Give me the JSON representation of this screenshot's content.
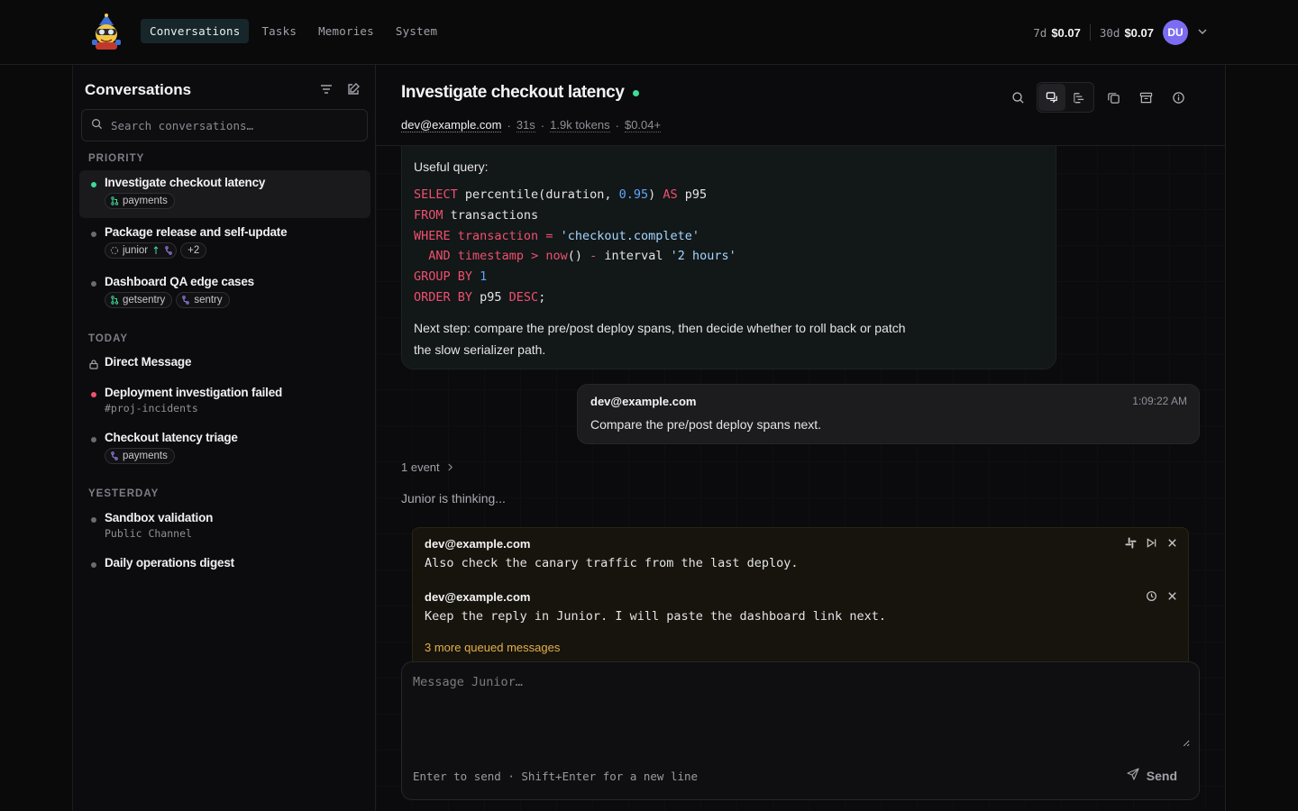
{
  "nav": {
    "items": [
      {
        "label": "Conversations",
        "active": true
      },
      {
        "label": "Tasks",
        "active": false
      },
      {
        "label": "Memories",
        "active": false
      },
      {
        "label": "System",
        "active": false
      }
    ]
  },
  "costs": {
    "week_label": "7d",
    "week_value": "$0.07",
    "month_label": "30d",
    "month_value": "$0.07",
    "avatar_initials": "DU"
  },
  "sidebar": {
    "title": "Conversations",
    "search_placeholder": "Search conversations…",
    "sections": {
      "priority": "PRIORITY",
      "today": "TODAY",
      "yesterday": "YESTERDAY"
    },
    "conversations": [
      {
        "title": "Investigate checkout latency",
        "tags": [
          "payments"
        ],
        "status": "active"
      },
      {
        "title": "Package release and self-update",
        "tags": [
          "junior",
          "+2"
        ]
      },
      {
        "title": "Dashboard QA edge cases",
        "tags": [
          "getsentry",
          "sentry"
        ]
      },
      {
        "title": "Direct Message"
      },
      {
        "title": "Deployment investigation failed",
        "sub": "#proj-incidents",
        "status": "failed"
      },
      {
        "title": "Checkout latency triage",
        "tags": [
          "payments"
        ]
      },
      {
        "title": "Sandbox validation",
        "sub": "Public Channel"
      },
      {
        "title": "Daily operations digest"
      }
    ]
  },
  "header": {
    "title": "Investigate checkout latency",
    "user": "dev@example.com",
    "duration": "31s",
    "tokens": "1.9k tokens",
    "cost": "$0.04+"
  },
  "assistant": {
    "intro": "Useful query:",
    "next_step": "Next step: compare the pre/post deploy spans, then decide whether to roll back or patch the slow serializer path."
  },
  "user_message": {
    "name": "dev@example.com",
    "time": "1:09:22 AM",
    "text": "Compare the pre/post deploy spans next."
  },
  "events_label": "1 event",
  "thinking": "Junior is thinking...",
  "queue": {
    "items": [
      {
        "name": "dev@example.com",
        "text": "Also check the canary traffic from the last deploy."
      },
      {
        "name": "dev@example.com",
        "text": "Keep the reply in Junior. I will paste the dashboard link next."
      }
    ],
    "more": "3 more queued messages"
  },
  "composer": {
    "placeholder": "Message Junior…",
    "hint": "Enter to send · Shift+Enter for a new line",
    "send_label": "Send"
  },
  "colors": {
    "accent_green": "#3ddc97",
    "error_red": "#f0506e",
    "avatar": "#7c6cf2",
    "queue_more": "#e3b04b"
  }
}
